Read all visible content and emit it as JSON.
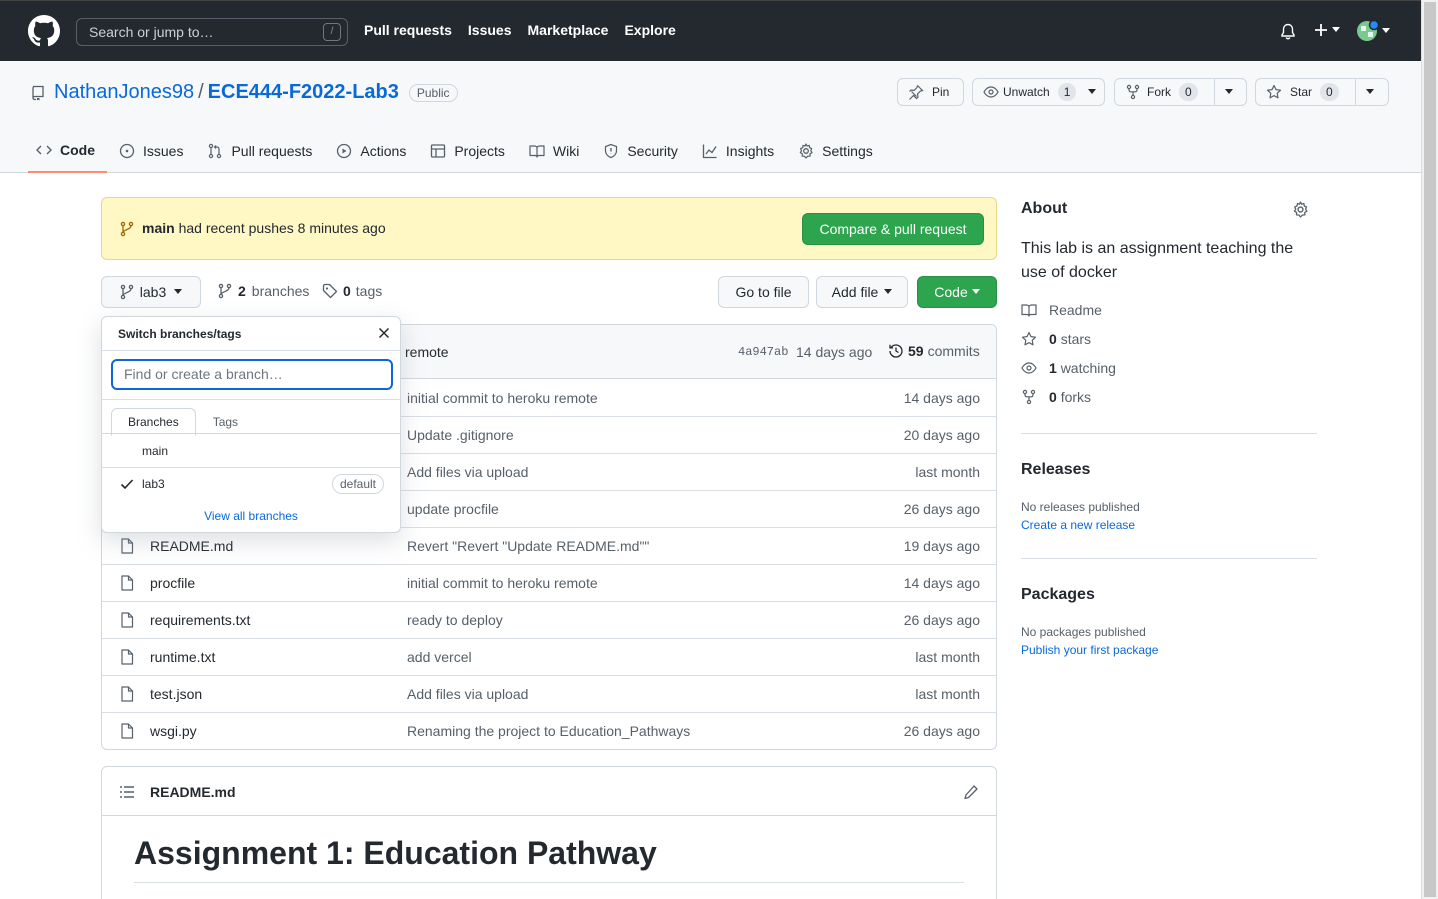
{
  "header": {
    "search_placeholder": "Search or jump to…",
    "search_shortcut": "/",
    "nav": [
      "Pull requests",
      "Issues",
      "Marketplace",
      "Explore"
    ]
  },
  "repo": {
    "owner": "NathanJones98",
    "separator": "/",
    "name": "ECE444-F2022-Lab3",
    "visibility": "Public",
    "pin_label": "Pin",
    "unwatch_label": "Unwatch",
    "watch_count": "1",
    "fork_label": "Fork",
    "fork_count": "0",
    "star_label": "Star",
    "star_count": "0"
  },
  "tabs": [
    {
      "label": "Code",
      "icon": "code-icon"
    },
    {
      "label": "Issues",
      "icon": "issue-icon"
    },
    {
      "label": "Pull requests",
      "icon": "pull-request-icon"
    },
    {
      "label": "Actions",
      "icon": "play-icon"
    },
    {
      "label": "Projects",
      "icon": "table-icon"
    },
    {
      "label": "Wiki",
      "icon": "book-icon"
    },
    {
      "label": "Security",
      "icon": "shield-icon"
    },
    {
      "label": "Insights",
      "icon": "graph-icon"
    },
    {
      "label": "Settings",
      "icon": "gear-icon"
    }
  ],
  "flash": {
    "branch": "main",
    "text": "had recent pushes 8 minutes ago",
    "button": "Compare & pull request"
  },
  "filenav": {
    "branch": "lab3",
    "branches_count": "2",
    "branches_label": "branches",
    "tags_count": "0",
    "tags_label": "tags",
    "go_to_file": "Go to file",
    "add_file": "Add file",
    "code": "Code"
  },
  "latest_commit": {
    "message_tail": "remote",
    "sha": "4a947ab",
    "age": "14 days ago",
    "commits_count": "59",
    "commits_label": "commits"
  },
  "files": [
    {
      "name": "",
      "message": "initial commit to heroku remote",
      "age": "14 days ago"
    },
    {
      "name": "",
      "message": "Update .gitignore",
      "age": "20 days ago"
    },
    {
      "name": "",
      "message": "Add files via upload",
      "age": "last month"
    },
    {
      "name": "",
      "message": "update procfile",
      "age": "26 days ago"
    },
    {
      "name": "README.md",
      "message": "Revert \"Revert \"Update README.md\"\"",
      "age": "19 days ago"
    },
    {
      "name": "procfile",
      "message": "initial commit to heroku remote",
      "age": "14 days ago"
    },
    {
      "name": "requirements.txt",
      "message": "ready to deploy",
      "age": "26 days ago"
    },
    {
      "name": "runtime.txt",
      "message": "add vercel",
      "age": "last month"
    },
    {
      "name": "test.json",
      "message": "Add files via upload",
      "age": "last month"
    },
    {
      "name": "wsgi.py",
      "message": "Renaming the project to Education_Pathways",
      "age": "26 days ago"
    }
  ],
  "dropdown": {
    "title": "Switch branches/tags",
    "placeholder": "Find or create a branch…",
    "tab_branches": "Branches",
    "tab_tags": "Tags",
    "items": [
      {
        "name": "main",
        "checked": false,
        "badge": ""
      },
      {
        "name": "lab3",
        "checked": true,
        "badge": "default"
      }
    ],
    "view_all": "View all branches"
  },
  "readme": {
    "filename": "README.md",
    "heading": "Assignment 1: Education Pathway"
  },
  "about": {
    "title": "About",
    "description": "This lab is an assignment teaching the use of docker",
    "readme": "Readme",
    "stars_count": "0",
    "stars_label": "stars",
    "watching_count": "1",
    "watching_label": "watching",
    "forks_count": "0",
    "forks_label": "forks"
  },
  "releases": {
    "title": "Releases",
    "empty": "No releases published",
    "link": "Create a new release"
  },
  "packages": {
    "title": "Packages",
    "empty": "No packages published",
    "link": "Publish your first package"
  },
  "colors": {
    "header_bg": "#24292f",
    "link": "#0969da",
    "green": "#2da44e",
    "flash_bg": "#fff8c5",
    "tab_underline": "#fd8c73"
  }
}
